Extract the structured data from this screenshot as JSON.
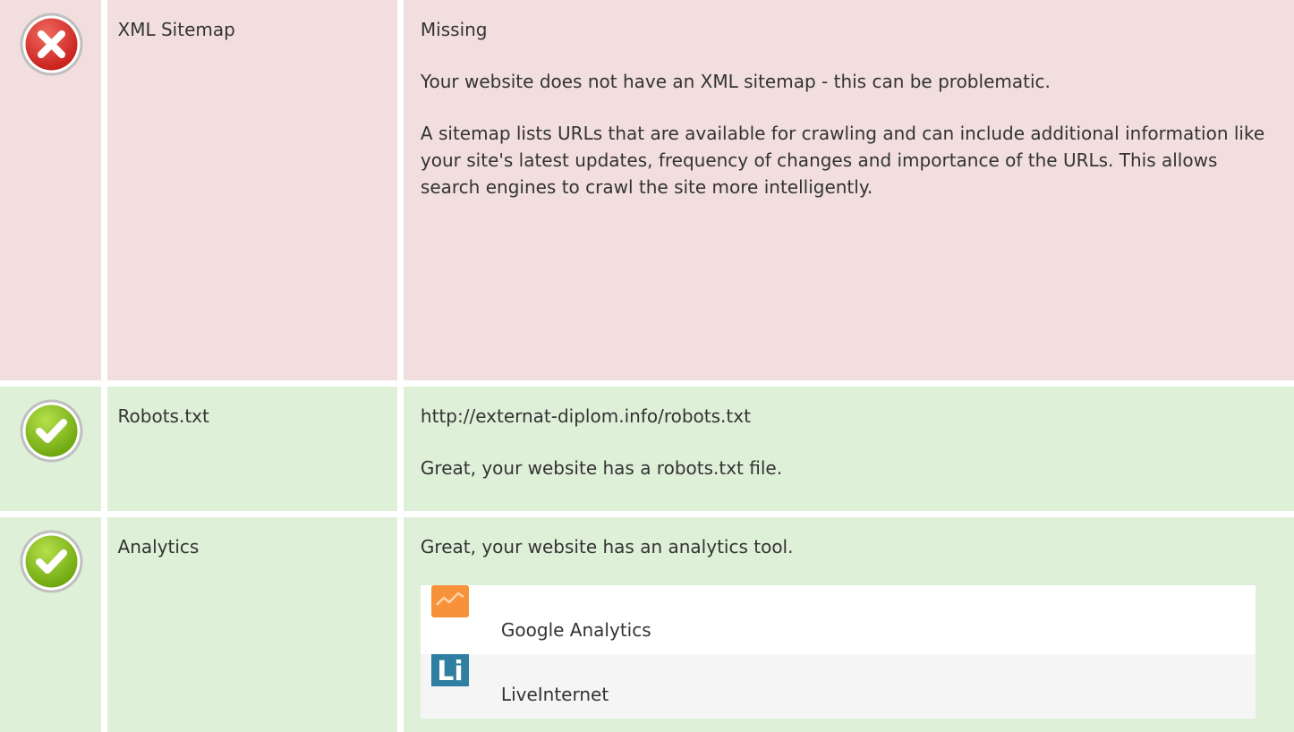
{
  "rows": [
    {
      "status": "fail",
      "name": "XML Sitemap",
      "paragraphs": [
        "Missing",
        "Your website does not have an XML sitemap - this can be problematic.",
        "A sitemap lists URLs that are available for crawling and can include additional information like your site's latest updates, frequency of changes and importance of the URLs. This allows search engines to crawl the site more intelligently."
      ]
    },
    {
      "status": "pass",
      "name": "Robots.txt",
      "paragraphs": [
        "http://externat-diplom.info/robots.txt",
        "Great, your website has a robots.txt file."
      ]
    },
    {
      "status": "pass",
      "name": "Analytics",
      "paragraphs": [
        "Great, your website has an analytics tool."
      ],
      "tools": [
        {
          "icon": "google-analytics-icon",
          "label": "Google Analytics"
        },
        {
          "icon": "liveinternet-icon",
          "label": "LiveInternet",
          "icon_text": "Li"
        }
      ]
    }
  ],
  "colors": {
    "fail_bg": "#f2dede",
    "pass_bg": "#dff0d8",
    "fail_icon": "#d9302c",
    "pass_icon": "#8cc21f",
    "ga_icon": "#f7913a",
    "li_icon": "#2e7fa0"
  }
}
